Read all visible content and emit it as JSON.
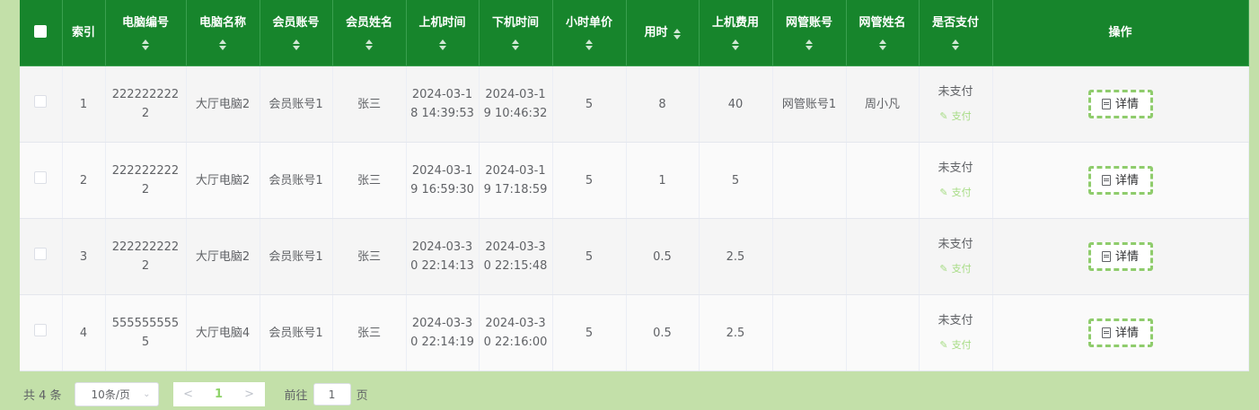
{
  "table": {
    "headers": {
      "index": "索引",
      "pc_no": "电脑编号",
      "pc_name": "电脑名称",
      "member_account": "会员账号",
      "member_name": "会员姓名",
      "start_time": "上机时间",
      "end_time": "下机时间",
      "unit_price": "小时单价",
      "hours": "用时",
      "fee": "上机费用",
      "admin_account": "网管账号",
      "admin_name": "网管姓名",
      "paid": "是否支付",
      "actions": "操作"
    },
    "rows": [
      {
        "index": "1",
        "pc_no": "2222222222",
        "pc_name": "大厅电脑2",
        "member_account": "会员账号1",
        "member_name": "张三",
        "start_time": "2024-03-18 14:39:53",
        "end_time": "2024-03-19 10:46:32",
        "unit_price": "5",
        "hours": "8",
        "fee": "40",
        "admin_account": "网管账号1",
        "admin_name": "周小凡",
        "paid": "未支付",
        "pay_label": "支付",
        "detail_label": "详情"
      },
      {
        "index": "2",
        "pc_no": "2222222222",
        "pc_name": "大厅电脑2",
        "member_account": "会员账号1",
        "member_name": "张三",
        "start_time": "2024-03-19 16:59:30",
        "end_time": "2024-03-19 17:18:59",
        "unit_price": "5",
        "hours": "1",
        "fee": "5",
        "admin_account": "",
        "admin_name": "",
        "paid": "未支付",
        "pay_label": "支付",
        "detail_label": "详情"
      },
      {
        "index": "3",
        "pc_no": "2222222222",
        "pc_name": "大厅电脑2",
        "member_account": "会员账号1",
        "member_name": "张三",
        "start_time": "2024-03-30 22:14:13",
        "end_time": "2024-03-30 22:15:48",
        "unit_price": "5",
        "hours": "0.5",
        "fee": "2.5",
        "admin_account": "",
        "admin_name": "",
        "paid": "未支付",
        "pay_label": "支付",
        "detail_label": "详情"
      },
      {
        "index": "4",
        "pc_no": "5555555555",
        "pc_name": "大厅电脑4",
        "member_account": "会员账号1",
        "member_name": "张三",
        "start_time": "2024-03-30 22:14:19",
        "end_time": "2024-03-30 22:16:00",
        "unit_price": "5",
        "hours": "0.5",
        "fee": "2.5",
        "admin_account": "",
        "admin_name": "",
        "paid": "未支付",
        "pay_label": "支付",
        "detail_label": "详情"
      }
    ]
  },
  "pagination": {
    "total_text": "共 4 条",
    "page_size": "10条/页",
    "current_page": "1",
    "goto_label": "前往",
    "goto_value": "1",
    "page_suffix": "页"
  },
  "icons": {
    "edit": "pencil-icon",
    "detail": "document-icon",
    "sort": "sort-caret-icon",
    "prev": "chevron-left-icon",
    "next": "chevron-right-icon",
    "dropdown": "chevron-down-icon"
  },
  "colors": {
    "header_bg": "#17852c",
    "page_bg": "#c3e0a9",
    "accent_green": "#8fcc6c"
  }
}
